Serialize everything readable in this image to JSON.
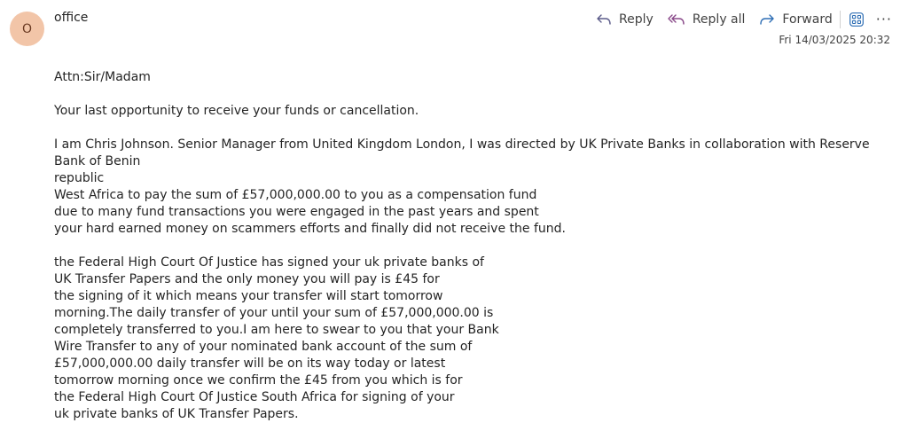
{
  "sender": {
    "initial": "O",
    "name": "office"
  },
  "actions": {
    "reply": "Reply",
    "reply_all": "Reply all",
    "forward": "Forward",
    "more": "···"
  },
  "date": "Fri 14/03/2025 20:32",
  "body": {
    "greeting": "Attn:Sir/Madam",
    "line1": "Your last opportunity to receive your funds or cancellation.",
    "p1": [
      "I am Chris Johnson. Senior Manager from United Kingdom London, I was directed by UK Private Banks  in collaboration with Reserve Bank of Benin",
      "republic",
      "West  Africa to pay the sum of £57,000,000.00 to you as a compensation fund",
      "due to many fund transactions you were engaged in the past years and spent",
      "your hard earned money on scammers efforts and finally did not receive the fund."
    ],
    "p2": [
      "the Federal High Court Of Justice has signed your uk private banks of",
      "UK Transfer Papers and the only money you will pay is £45  for",
      "the signing of it which means your transfer will start tomorrow",
      "morning.The daily transfer of your until your sum of £57,000,000.00 is",
      "completely transferred to you.I am here to swear to you that your Bank",
      "Wire Transfer to any of your nominated bank account of the sum of",
      "£57,000,000.00 daily transfer will be on its way today or latest",
      "tomorrow morning once we confirm the £45  from you which is for",
      "the Federal High Court Of Justice South Africa for signing of your",
      "uk private banks of UK Transfer Papers."
    ]
  },
  "colors": {
    "avatar_bg": "#f2c5a8",
    "reply_icon": "#5c5c8a",
    "reply_all_icon": "#8a4a8a",
    "forward_icon": "#2f6fb5",
    "apps_icon": "#2f6fb5"
  },
  "icons": [
    "reply-icon",
    "reply-all-icon",
    "forward-icon",
    "apps-icon",
    "more-icon"
  ]
}
